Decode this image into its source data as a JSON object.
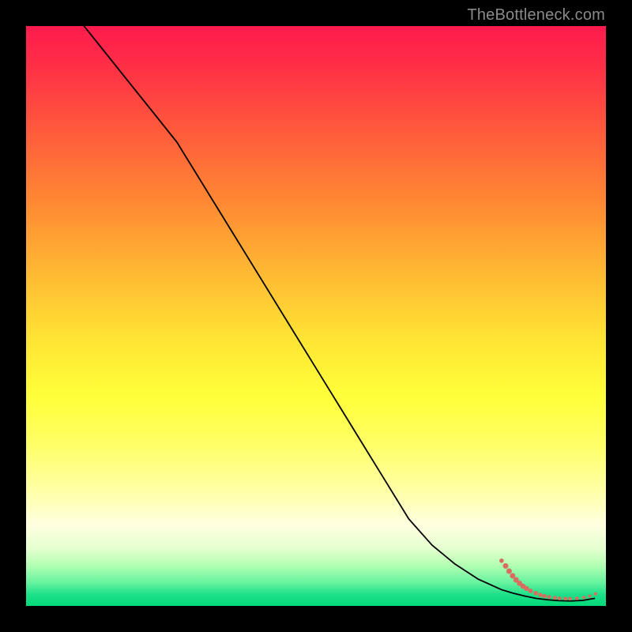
{
  "attribution": "TheBottleneck.com",
  "chart_data": {
    "type": "line",
    "title": "",
    "xlabel": "",
    "ylabel": "",
    "xlim": [
      0,
      100
    ],
    "ylim": [
      0,
      100
    ],
    "background_gradient": {
      "top": "#ff1a4d",
      "middle": "#ffff3a",
      "bottom": "#00d977"
    },
    "series": [
      {
        "name": "curve",
        "x": [
          10,
          14,
          18,
          22,
          26,
          30,
          34,
          38,
          42,
          46,
          50,
          54,
          58,
          62,
          66,
          70,
          74,
          78,
          82,
          84,
          86,
          88,
          90,
          92,
          94,
          96,
          98
        ],
        "y": [
          100,
          95,
          90,
          85,
          80,
          73.5,
          67,
          60.5,
          54,
          47.5,
          41,
          34.5,
          28,
          21.5,
          15,
          10.5,
          7.2,
          4.6,
          2.8,
          2.2,
          1.7,
          1.3,
          1.05,
          0.9,
          0.85,
          0.95,
          1.3
        ],
        "color": "#000000"
      }
    ],
    "markers": {
      "name": "bottom-cluster",
      "color": "#d86e5f",
      "points": [
        {
          "x": 82.0,
          "y": 7.8,
          "r": 2.8
        },
        {
          "x": 82.7,
          "y": 6.9,
          "r": 3.5
        },
        {
          "x": 83.3,
          "y": 6.0,
          "r": 3.5
        },
        {
          "x": 83.9,
          "y": 5.2,
          "r": 3.5
        },
        {
          "x": 84.5,
          "y": 4.5,
          "r": 3.5
        },
        {
          "x": 85.1,
          "y": 3.9,
          "r": 3.4
        },
        {
          "x": 85.7,
          "y": 3.4,
          "r": 3.3
        },
        {
          "x": 86.3,
          "y": 3.0,
          "r": 3.2
        },
        {
          "x": 87.0,
          "y": 2.6,
          "r": 2.9
        },
        {
          "x": 87.9,
          "y": 2.2,
          "r": 2.9
        },
        {
          "x": 88.7,
          "y": 1.9,
          "r": 2.7
        },
        {
          "x": 89.4,
          "y": 1.7,
          "r": 2.7
        },
        {
          "x": 90.2,
          "y": 1.55,
          "r": 2.5
        },
        {
          "x": 91.2,
          "y": 1.4,
          "r": 2.5
        },
        {
          "x": 92.0,
          "y": 1.3,
          "r": 2.4
        },
        {
          "x": 93.0,
          "y": 1.25,
          "r": 2.4
        },
        {
          "x": 93.8,
          "y": 1.25,
          "r": 2.4
        },
        {
          "x": 95.0,
          "y": 1.3,
          "r": 2.3
        },
        {
          "x": 96.2,
          "y": 1.45,
          "r": 2.2
        },
        {
          "x": 97.2,
          "y": 1.7,
          "r": 2.1
        },
        {
          "x": 98.2,
          "y": 2.1,
          "r": 2.0
        }
      ]
    }
  }
}
